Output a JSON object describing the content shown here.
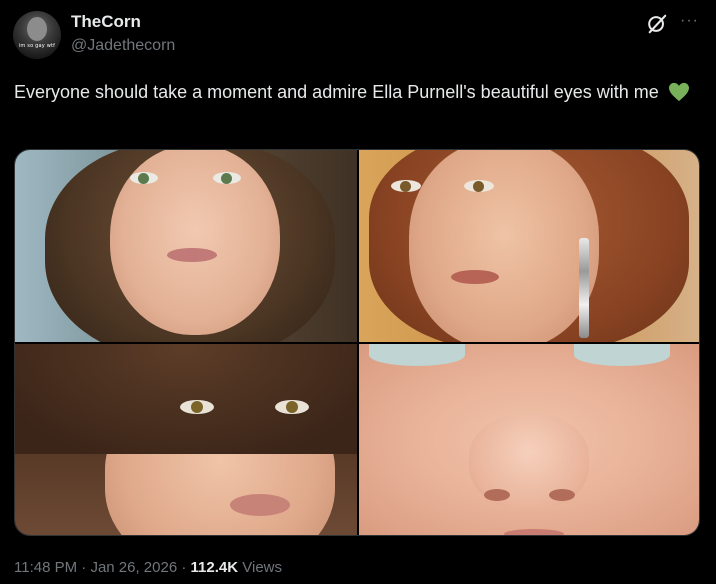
{
  "author": {
    "name": "TheCorn",
    "handle": "@Jadethecorn",
    "avatar_text": "im so gay wtf"
  },
  "tweet": {
    "text": "Everyone should take a moment and admire Ella Purnell's beautiful eyes with me",
    "emoji": "green-heart"
  },
  "media": [
    {
      "label": "photo-1"
    },
    {
      "label": "photo-2"
    },
    {
      "label": "photo-3"
    },
    {
      "label": "photo-4"
    }
  ],
  "meta": {
    "time": "11:48 PM",
    "separator": "·",
    "date": "Jan 26, 2026",
    "views_count": "112.4K",
    "views_label": "Views"
  },
  "icons": {
    "grok": "grok-icon",
    "more": "more-horizontal-icon",
    "heart": "green-heart-icon"
  },
  "colors": {
    "background": "#000000",
    "primary_text": "#e7e9ea",
    "secondary_text": "#71767b",
    "heart": "#78b159"
  }
}
